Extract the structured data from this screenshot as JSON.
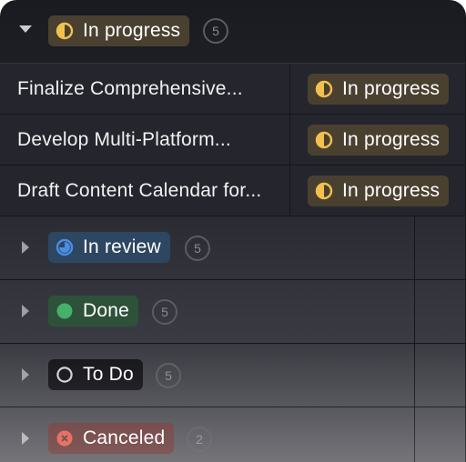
{
  "groups": [
    {
      "label": "In progress",
      "count": "5",
      "icon": "half-circle-icon",
      "color": "#f2c14e",
      "expanded": true
    },
    {
      "label": "In review",
      "count": "5",
      "icon": "progress-circle-icon",
      "color": "#4b8de0",
      "expanded": false
    },
    {
      "label": "Done",
      "count": "5",
      "icon": "check-circle-icon",
      "color": "#45b06a",
      "expanded": false
    },
    {
      "label": "To Do",
      "count": "5",
      "icon": "empty-circle-icon",
      "color": "#d0d0d5",
      "expanded": false
    },
    {
      "label": "Canceled",
      "count": "2",
      "icon": "x-circle-icon",
      "color": "#e45f4e",
      "expanded": false
    }
  ],
  "rows": [
    {
      "title": "Finalize Comprehensive...",
      "status": "In progress"
    },
    {
      "title": "Develop Multi-Platform...",
      "status": "In progress"
    },
    {
      "title": "Draft Content Calendar for...",
      "status": "In progress"
    }
  ]
}
